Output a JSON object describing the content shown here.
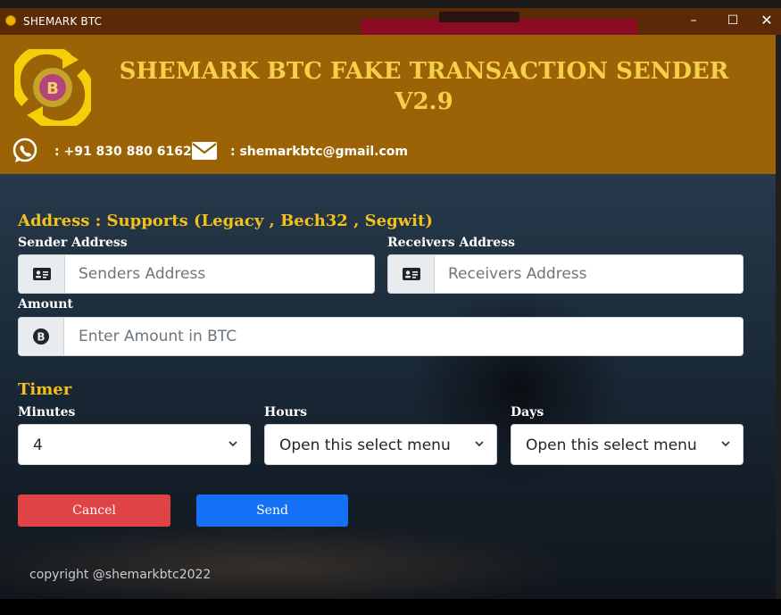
{
  "window": {
    "title": "SHEMARK BTC",
    "minimize": "–",
    "maximize": "☐",
    "close": "✕"
  },
  "header": {
    "title": "SHEMARK BTC FAKE TRANSACTION SENDER V2.9",
    "phone": ": +91 830 880 6162",
    "email": ": shemarkbtc@gmail.com",
    "logo_icon": "bitcoin-refresh-logo",
    "brand_color": "#9b6206",
    "accent_color": "#f6d04a"
  },
  "address_section": {
    "title": "Address : Supports (Legacy , Bech32 , Segwit)",
    "sender_label": "Sender Address",
    "sender_placeholder": "Senders Address",
    "receiver_label": "Receivers Address",
    "receiver_placeholder": "Receivers Address",
    "amount_label": "Amount",
    "amount_placeholder": "Enter Amount in BTC"
  },
  "timer": {
    "title": "Timer",
    "minutes_label": "Minutes",
    "minutes_value": "4",
    "hours_label": "Hours",
    "hours_value": "Open this select menu",
    "days_label": "Days",
    "days_value": "Open this select menu"
  },
  "actions": {
    "cancel_label": "Cancel",
    "send_label": "Send",
    "cancel_color": "#e04346",
    "send_color": "#1471f5"
  },
  "footer": {
    "copyright": "copyright @shemarkbtc2022"
  }
}
